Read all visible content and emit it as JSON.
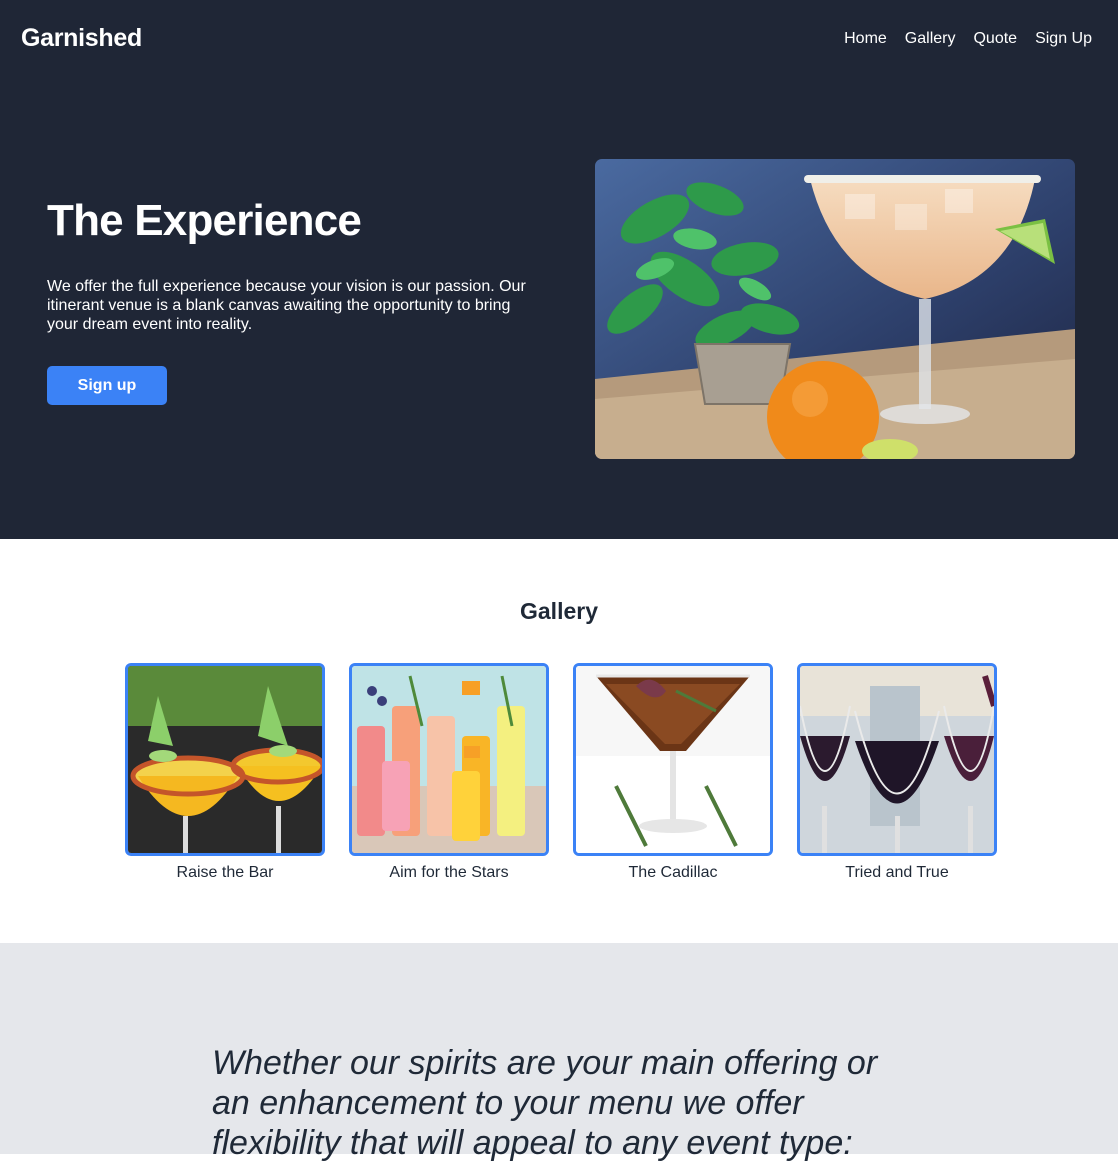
{
  "header": {
    "brand": "Garnished",
    "nav": [
      "Home",
      "Gallery",
      "Quote",
      "Sign Up"
    ]
  },
  "hero": {
    "title": "The Experience",
    "text": "We offer the full experience because your vision is our passion. Our itinerant venue is a blank canvas awaiting the opportunity to bring your dream event into reality.",
    "button_label": "Sign up"
  },
  "gallery": {
    "title": "Gallery",
    "items": [
      {
        "label": "Raise the Bar"
      },
      {
        "label": "Aim for the Stars"
      },
      {
        "label": "The Cadillac"
      },
      {
        "label": "Tried and True"
      }
    ]
  },
  "quote": {
    "text": "Whether our spirits are your main offering or an enhancement to your menu we offer flexibility that will appeal to any event type:"
  },
  "colors": {
    "hero_bg": "#1f2636",
    "accent": "#3b82f6",
    "quote_bg": "#e5e7eb"
  }
}
